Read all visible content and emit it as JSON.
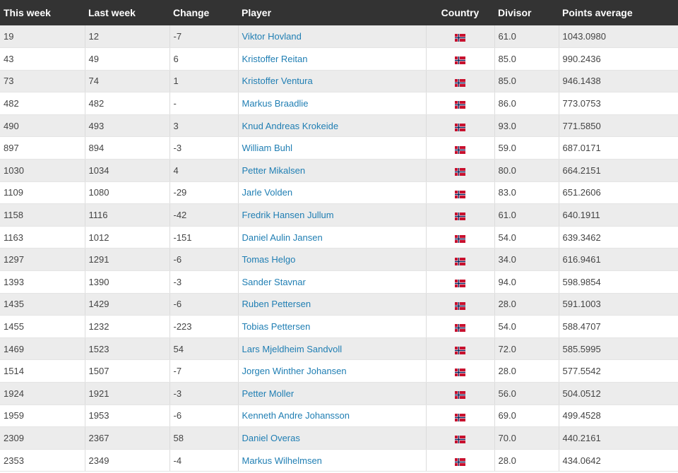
{
  "table": {
    "headers": {
      "this_week": "This week",
      "last_week": "Last week",
      "change": "Change",
      "player": "Player",
      "country": "Country",
      "divisor": "Divisor",
      "points_average": "Points average"
    },
    "flag_icon": "norway-flag-icon",
    "colors": {
      "header_bg": "#333333",
      "link": "#1f7eb3",
      "row_alt": "#ececec",
      "flag_red": "#c8102e",
      "flag_blue": "#00205b"
    },
    "rows": [
      {
        "this_week": "19",
        "last_week": "12",
        "change": "-7",
        "player": "Viktor Hovland",
        "divisor": "61.0",
        "points": "1043.0980"
      },
      {
        "this_week": "43",
        "last_week": "49",
        "change": "6",
        "player": "Kristoffer Reitan",
        "divisor": "85.0",
        "points": "990.2436"
      },
      {
        "this_week": "73",
        "last_week": "74",
        "change": "1",
        "player": "Kristoffer Ventura",
        "divisor": "85.0",
        "points": "946.1438"
      },
      {
        "this_week": "482",
        "last_week": "482",
        "change": "-",
        "player": "Markus Braadlie",
        "divisor": "86.0",
        "points": "773.0753"
      },
      {
        "this_week": "490",
        "last_week": "493",
        "change": "3",
        "player": "Knud Andreas Krokeide",
        "divisor": "93.0",
        "points": "771.5850"
      },
      {
        "this_week": "897",
        "last_week": "894",
        "change": "-3",
        "player": "William Buhl",
        "divisor": "59.0",
        "points": "687.0171"
      },
      {
        "this_week": "1030",
        "last_week": "1034",
        "change": "4",
        "player": "Petter Mikalsen",
        "divisor": "80.0",
        "points": "664.2151"
      },
      {
        "this_week": "1109",
        "last_week": "1080",
        "change": "-29",
        "player": "Jarle Volden",
        "divisor": "83.0",
        "points": "651.2606"
      },
      {
        "this_week": "1158",
        "last_week": "1116",
        "change": "-42",
        "player": "Fredrik Hansen Jullum",
        "divisor": "61.0",
        "points": "640.1911"
      },
      {
        "this_week": "1163",
        "last_week": "1012",
        "change": "-151",
        "player": "Daniel Aulin Jansen",
        "divisor": "54.0",
        "points": "639.3462"
      },
      {
        "this_week": "1297",
        "last_week": "1291",
        "change": "-6",
        "player": "Tomas Helgo",
        "divisor": "34.0",
        "points": "616.9461"
      },
      {
        "this_week": "1393",
        "last_week": "1390",
        "change": "-3",
        "player": "Sander Stavnar",
        "divisor": "94.0",
        "points": "598.9854"
      },
      {
        "this_week": "1435",
        "last_week": "1429",
        "change": "-6",
        "player": "Ruben Pettersen",
        "divisor": "28.0",
        "points": "591.1003"
      },
      {
        "this_week": "1455",
        "last_week": "1232",
        "change": "-223",
        "player": "Tobias Pettersen",
        "divisor": "54.0",
        "points": "588.4707"
      },
      {
        "this_week": "1469",
        "last_week": "1523",
        "change": "54",
        "player": "Lars Mjeldheim Sandvoll",
        "divisor": "72.0",
        "points": "585.5995"
      },
      {
        "this_week": "1514",
        "last_week": "1507",
        "change": "-7",
        "player": "Jorgen Winther Johansen",
        "divisor": "28.0",
        "points": "577.5542"
      },
      {
        "this_week": "1924",
        "last_week": "1921",
        "change": "-3",
        "player": "Petter Moller",
        "divisor": "56.0",
        "points": "504.0512"
      },
      {
        "this_week": "1959",
        "last_week": "1953",
        "change": "-6",
        "player": "Kenneth Andre Johansson",
        "divisor": "69.0",
        "points": "499.4528"
      },
      {
        "this_week": "2309",
        "last_week": "2367",
        "change": "58",
        "player": "Daniel Overas",
        "divisor": "70.0",
        "points": "440.2161"
      },
      {
        "this_week": "2353",
        "last_week": "2349",
        "change": "-4",
        "player": "Markus Wilhelmsen",
        "divisor": "28.0",
        "points": "434.0642"
      }
    ]
  }
}
